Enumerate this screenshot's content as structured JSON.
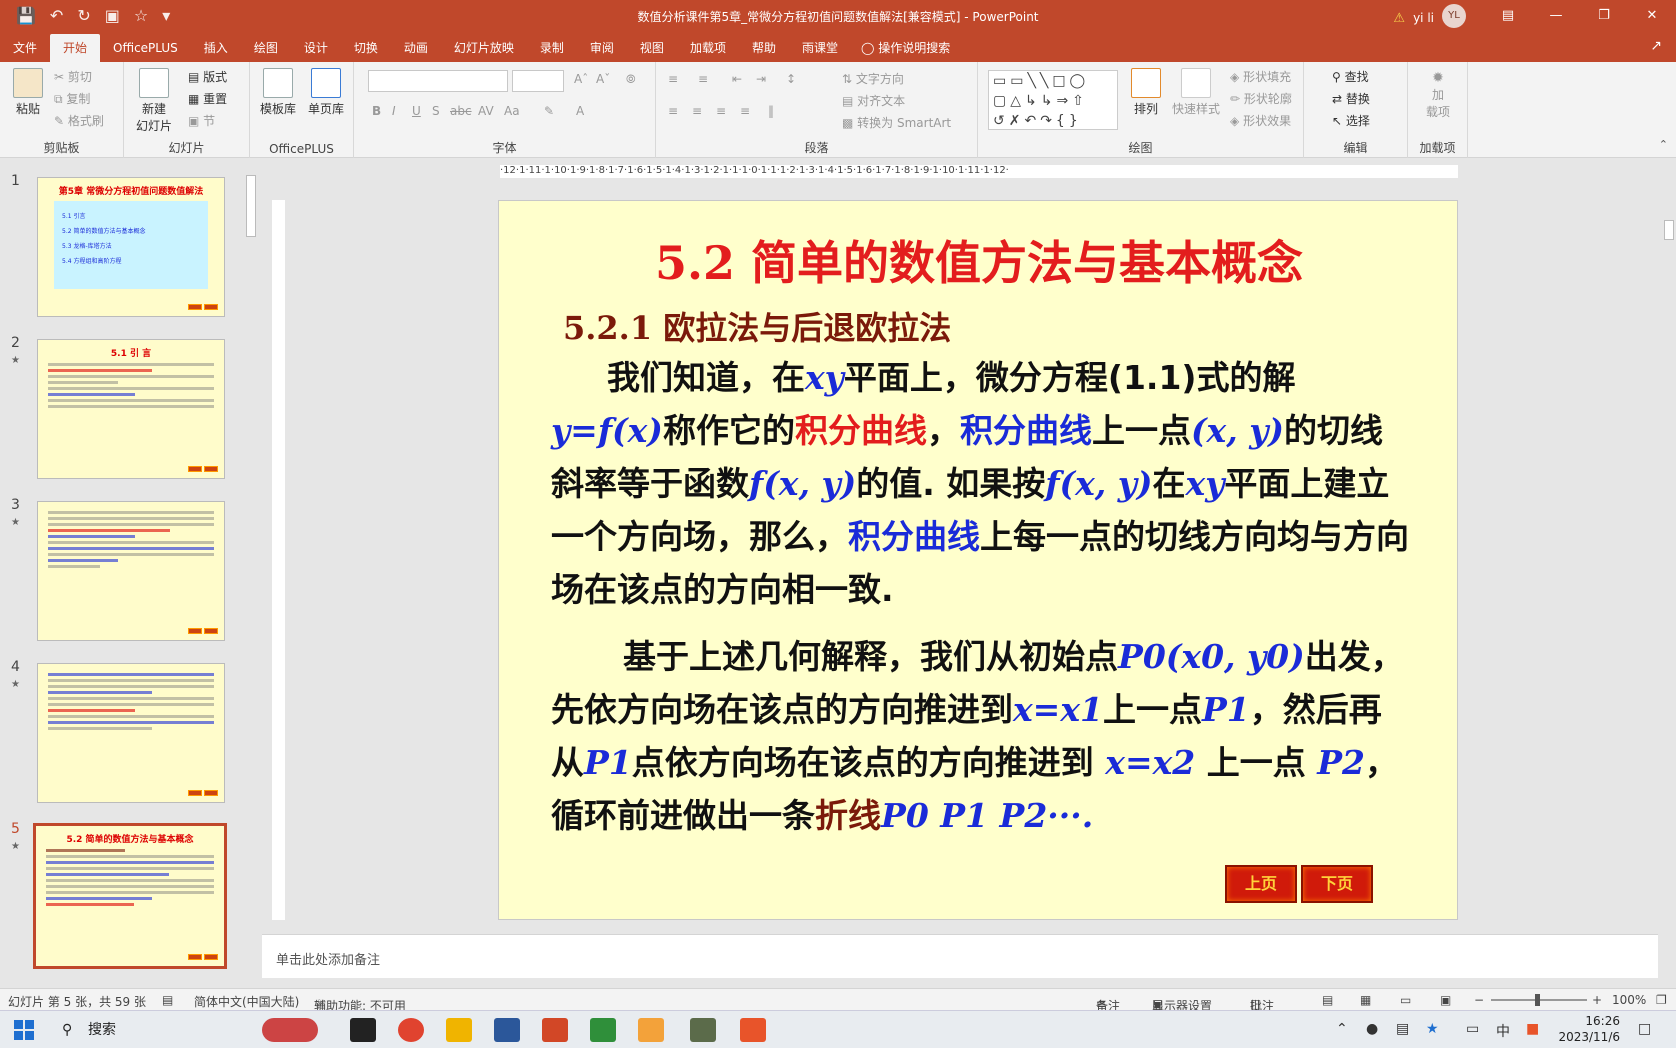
{
  "window": {
    "title": "数值分析课件第5章_常微分方程初值问题数值解法[兼容模式] - PowerPoint",
    "user": "yi li",
    "avatar": "YL"
  },
  "tabs": [
    "文件",
    "开始",
    "OfficePLUS",
    "插入",
    "绘图",
    "设计",
    "切换",
    "动画",
    "幻灯片放映",
    "录制",
    "审阅",
    "视图",
    "加载项",
    "帮助",
    "雨课堂"
  ],
  "active_tab": "开始",
  "tell_me": "操作说明搜索",
  "ribbon": {
    "clipboard": {
      "label": "剪贴板",
      "paste": "粘贴",
      "cut": "剪切",
      "copy": "复制",
      "format": "格式刷"
    },
    "slides": {
      "label": "幻灯片",
      "new": "新建",
      "new2": "幻灯片",
      "layout": "版式",
      "reset": "重置",
      "section": "节"
    },
    "officeplus": {
      "label": "OfficePLUS",
      "template": "模板库",
      "single": "单页库"
    },
    "font": {
      "label": "字体"
    },
    "paragraph": {
      "label": "段落",
      "text_direction": "文字方向",
      "align_text": "对齐文本",
      "smartart": "转换为 SmartArt"
    },
    "drawing": {
      "label": "绘图",
      "arrange": "排列",
      "quick_styles": "快速样式",
      "fill": "形状填充",
      "outline": "形状轮廓",
      "effects": "形状效果"
    },
    "editing": {
      "label": "编辑",
      "find": "查找",
      "replace": "替换",
      "select": "选择"
    },
    "addins": {
      "label": "加载项",
      "btn1": "加",
      "btn2": "载项"
    }
  },
  "thumbnails": [
    {
      "num": "1",
      "title": "第5章  常微分方程初值问题数值解法",
      "items": [
        "5.1 引言",
        "5.2 简单的数值方法与基本概念",
        "5.3 龙格-库塔方法",
        "5.4 方程组和高阶方程"
      ]
    },
    {
      "num": "2",
      "title": "5.1  引  言"
    },
    {
      "num": "3",
      "title": ""
    },
    {
      "num": "4",
      "title": ""
    },
    {
      "num": "5",
      "title": "5.2  简单的数值方法与基本概念"
    }
  ],
  "slide": {
    "title": "5.2  简单的数值方法与基本概念",
    "subtitle": "5.2.1   欧拉法与后退欧拉法",
    "p1": {
      "a": "我们知道，在",
      "xy": "xy",
      "b": "平面上，微分方程(1.1)式的解",
      "yfx": "y=f(x)",
      "c": "称作它的",
      "curve1": "积分曲线",
      "comma": "，",
      "curve2": "积分曲线",
      "d": "上一点",
      "pt": "(x, y)",
      "e": "的切线斜率等于函数",
      "fxy1": "f(x, y)",
      "f": "的值. 如果按",
      "fxy2": "f(x, y)",
      "g": "在",
      "xy2": "xy",
      "h": "平面上建立一个方向场，那么，",
      "curve3": "积分曲线",
      "i": "上每一点的切线方向均与方向场在该点的方向相一致."
    },
    "p2": {
      "a": "基于上述几何解释，我们从初始点",
      "p0": "P0(x0, y0)",
      "b": "出发，先依方向场在该点的方向推进到",
      "x1": "x=x1",
      "c": "上一点",
      "P1": "P1",
      "d": "，然后再从",
      "P1b": "P1",
      "e": "点依方向场在该点的方向推进到",
      "x2": " x=x2",
      "f": " 上一点",
      "P2": "P2",
      "g": "，循环前进做出一条",
      "poly": "折线",
      "seq": "P0 P1 P2···."
    },
    "prev": "上页",
    "next": "下页"
  },
  "ruler": "·12·1·11·1·10·1·9·1·8·1·7·1·6·1·5·1·4·1·3·1·2·1·1·1·0·1·1·1·2·1·3·1·4·1·5·1·6·1·7·1·8·1·9·1·10·1·11·1·12·",
  "notes_placeholder": "单击此处添加备注",
  "status": {
    "slide_info": "幻灯片 第 5 张，共 59 张",
    "language": "简体中文(中国大陆)",
    "accessibility": "辅助功能: 不可用",
    "notes": "备注",
    "display": "显示器设置",
    "comments": "批注",
    "zoom": "100%"
  },
  "taskbar": {
    "search": "搜索",
    "time": "16:26",
    "date": "2023/11/6",
    "ime": "中"
  },
  "colors": {
    "accent": "#c0482b",
    "slide_bg": "#ffffcc",
    "title_red": "#e31d1d",
    "blue": "#1a2bd8"
  }
}
